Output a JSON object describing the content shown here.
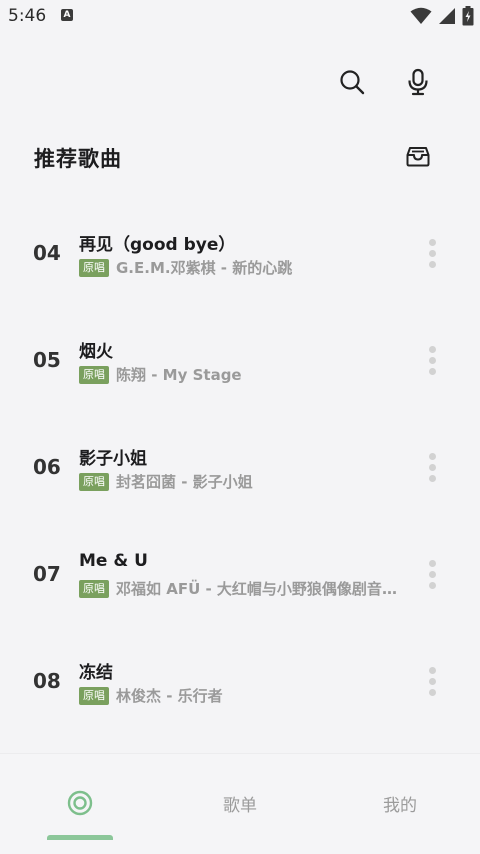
{
  "status_bar": {
    "time": "5:46",
    "notification_letter": "A"
  },
  "header": {
    "title": "推荐歌曲"
  },
  "songs": [
    {
      "number": "04",
      "title": "再见（good bye）",
      "badge": "原唱",
      "artist": "G.E.M.邓紫棋 - 新的心跳"
    },
    {
      "number": "05",
      "title": "烟火",
      "badge": "原唱",
      "artist": "陈翔 - My Stage"
    },
    {
      "number": "06",
      "title": "影子小姐",
      "badge": "原唱",
      "artist": "封茗囧菌 - 影子小姐"
    },
    {
      "number": "07",
      "title": "Me & U",
      "badge": "原唱",
      "artist": "邓福如 AFÜ - 大红帽与小野狼偶像剧音乐原声"
    },
    {
      "number": "08",
      "title": "冻结",
      "badge": "原唱",
      "artist": "林俊杰 - 乐行者"
    }
  ],
  "bottom_nav": {
    "items": [
      {
        "label": "",
        "icon": "home-target-icon",
        "active": true
      },
      {
        "label": "歌单",
        "active": false
      },
      {
        "label": "我的",
        "active": false
      }
    ]
  },
  "colors": {
    "accent_green": "#7aa05e",
    "nav_indicator": "#8cc79a",
    "background": "#f4f4f6"
  }
}
